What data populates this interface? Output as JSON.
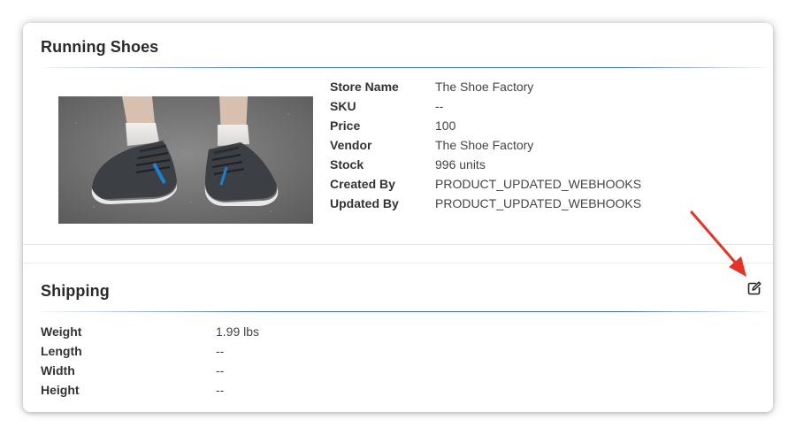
{
  "product": {
    "title": "Running Shoes",
    "image_alt": "running-shoes-photo",
    "details": [
      {
        "label": "Store Name",
        "value": "The Shoe Factory"
      },
      {
        "label": "SKU",
        "value": "--"
      },
      {
        "label": "Price",
        "value": "100"
      },
      {
        "label": "Vendor",
        "value": "The Shoe Factory"
      },
      {
        "label": "Stock",
        "value": "996 units"
      },
      {
        "label": "Created By",
        "value": "PRODUCT_UPDATED_WEBHOOKS"
      },
      {
        "label": "Updated By",
        "value": "PRODUCT_UPDATED_WEBHOOKS"
      }
    ]
  },
  "shipping": {
    "title": "Shipping",
    "edit_icon": "edit-icon",
    "details": [
      {
        "label": "Weight",
        "value": "1.99 lbs"
      },
      {
        "label": "Length",
        "value": "--"
      },
      {
        "label": "Width",
        "value": "--"
      },
      {
        "label": "Height",
        "value": "--"
      }
    ]
  },
  "colors": {
    "title_rule": "#3f6fa6",
    "annotation_arrow": "#e53325"
  }
}
